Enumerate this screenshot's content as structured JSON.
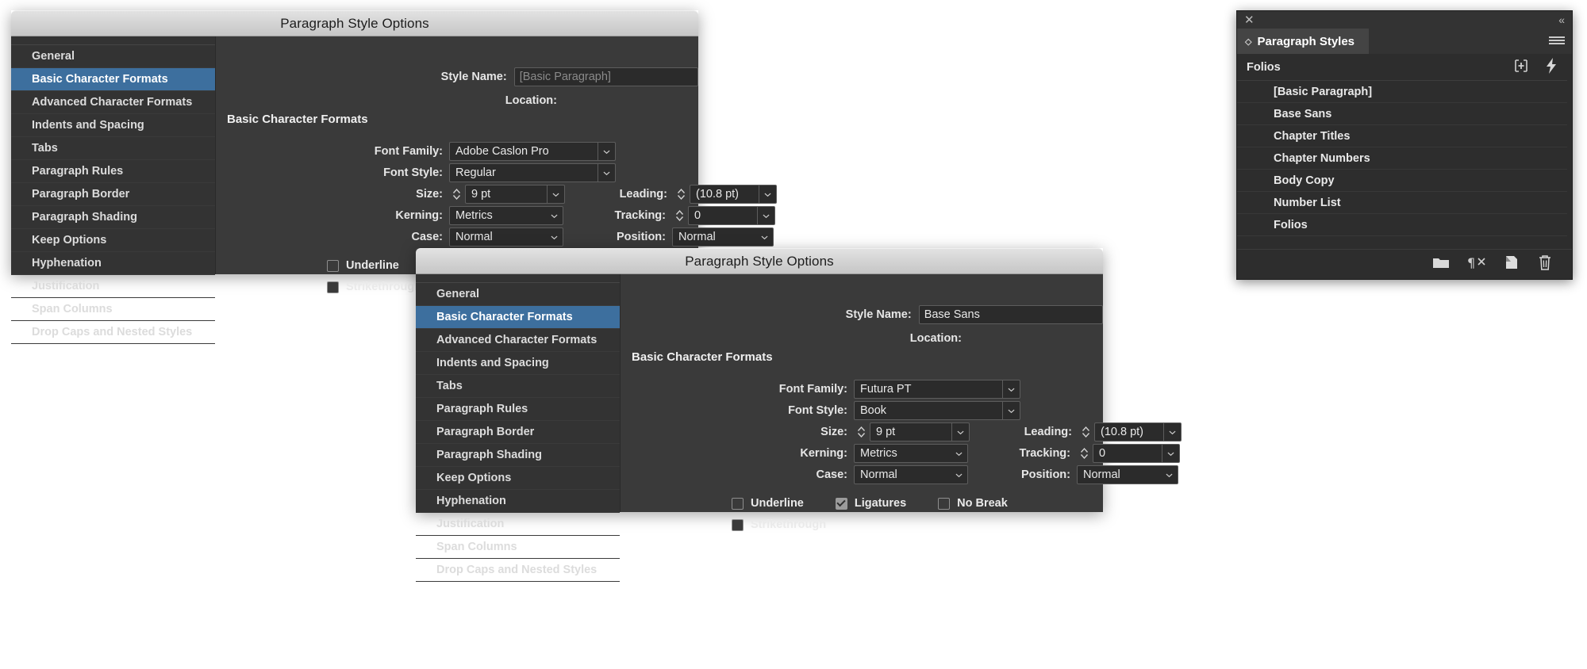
{
  "app": {
    "dialog_title": "Paragraph Style Options",
    "section_heading": "Basic Character Formats",
    "labels": {
      "style_name": "Style Name:",
      "location": "Location:",
      "font_family": "Font Family:",
      "font_style": "Font Style:",
      "size": "Size:",
      "leading": "Leading:",
      "kerning": "Kerning:",
      "tracking": "Tracking:",
      "case": "Case:",
      "position": "Position:",
      "underline": "Underline",
      "ligatures": "Ligatures",
      "no_break": "No Break",
      "strikethrough": "Strikethrough"
    },
    "categories": [
      "General",
      "Basic Character Formats",
      "Advanced Character Formats",
      "Indents and Spacing",
      "Tabs",
      "Paragraph Rules",
      "Paragraph Border",
      "Paragraph Shading",
      "Keep Options",
      "Hyphenation",
      "Justification",
      "Span Columns",
      "Drop Caps and Nested Styles"
    ],
    "selected_category": "Basic Character Formats",
    "accent_selection": "#3d6f9e"
  },
  "dialog1": {
    "title": "Paragraph Style Options",
    "style_name_value": "",
    "style_name_placeholder": "[Basic Paragraph]",
    "location_value": "",
    "font_family": "Adobe Caslon Pro",
    "font_style": "Regular",
    "size": "9 pt",
    "leading": "(10.8 pt)",
    "kerning": "Metrics",
    "tracking": "0",
    "case": "Normal",
    "position": "Normal",
    "underline_checked": false,
    "ligatures_checked": true,
    "no_break_checked": false,
    "strikethrough_checked": false
  },
  "dialog2": {
    "title": "Paragraph Style Options",
    "style_name_value": "Base Sans",
    "style_name_placeholder": "",
    "location_value": "",
    "font_family": "Futura PT",
    "font_style": "Book",
    "size": "9 pt",
    "leading": "(10.8 pt)",
    "kerning": "Metrics",
    "tracking": "0",
    "case": "Normal",
    "position": "Normal",
    "underline_checked": false,
    "ligatures_checked": true,
    "no_break_checked": false,
    "strikethrough_checked": false
  },
  "paragraph_styles_panel": {
    "panel_title": "Paragraph Styles",
    "current_style": "Folios",
    "close_icon": "close-icon",
    "collapse_icon": "double-chevron-left-icon",
    "menu_icon": "panel-menu-icon",
    "new_group_icon": "new-style-group-icon",
    "quick_apply_icon": "quick-apply-lightning-icon",
    "items": [
      "[Basic Paragraph]",
      "Base Sans",
      "Chapter Titles",
      "Chapter Numbers",
      "Body Copy",
      "Number List",
      "Folios"
    ],
    "footer_icons": [
      "new-style-group-folder-icon",
      "clear-overrides-icon",
      "new-style-icon",
      "delete-style-trash-icon"
    ]
  }
}
